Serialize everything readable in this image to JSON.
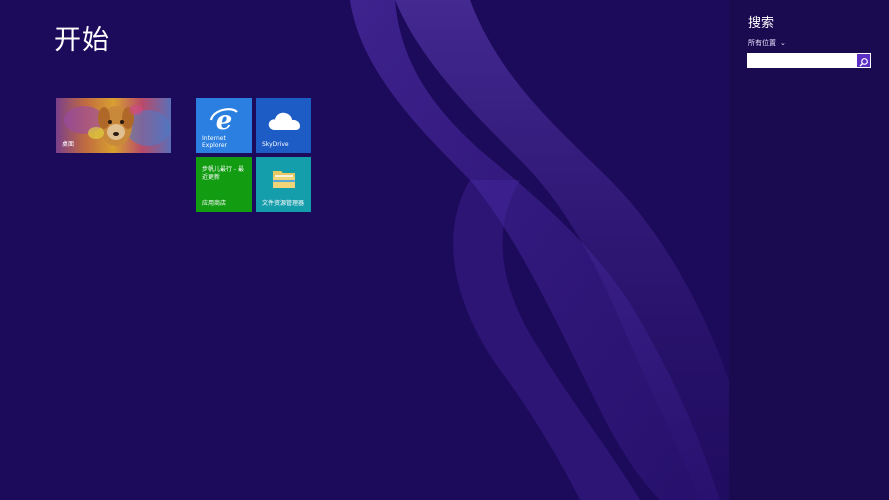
{
  "start": {
    "title": "开始"
  },
  "tiles": {
    "desktop": {
      "label": "桌面"
    },
    "ie": {
      "label_line1": "Internet",
      "label_line2": "Explorer"
    },
    "skydrive": {
      "label": "SkyDrive"
    },
    "store": {
      "text": "步帆儿最行 - 最近更新",
      "label": "应用商店"
    },
    "explorer": {
      "label": "文件资源管理器"
    }
  },
  "search": {
    "title": "搜索",
    "scope": "所有位置",
    "query": "",
    "placeholder": ""
  },
  "colors": {
    "background": "#1c0a5a",
    "charm_background": "#1a0a50",
    "ie_tile": "#2a7fe0",
    "skydrive_tile": "#1c5cc4",
    "store_tile": "#119c11",
    "explorer_tile": "#149dab",
    "search_button": "#5b2fc4"
  },
  "icons": {
    "ie": "internet-explorer-icon",
    "skydrive": "cloud-icon",
    "explorer": "folder-icon",
    "search": "search-icon",
    "scope_dropdown": "chevron-down-icon"
  }
}
